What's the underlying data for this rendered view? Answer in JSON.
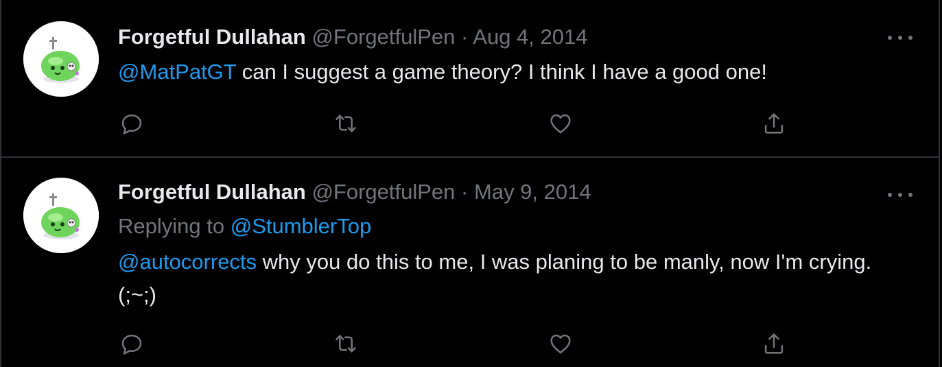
{
  "tweets": [
    {
      "author_name": "Forgetful Dullahan",
      "handle": "@ForgetfulPen",
      "separator": "·",
      "date": "Aug 4, 2014",
      "replying_label": "",
      "replying_to": "",
      "mention": "@MatPatGT",
      "text": " can I suggest a game theory? I think I have a good one!"
    },
    {
      "author_name": "Forgetful Dullahan",
      "handle": "@ForgetfulPen",
      "separator": "·",
      "date": "May 9, 2014",
      "replying_label": "Replying to ",
      "replying_to": "@StumblerTop",
      "mention": "@autocorrects",
      "text": " why you do this to me, I was planing to be manly, now I'm crying. (;~;)"
    }
  ],
  "icons": {
    "avatar": "green-slime-avatar-icon",
    "more": "more-options-icon",
    "reply": "reply-icon",
    "retweet": "retweet-icon",
    "like": "heart-icon",
    "share": "share-icon"
  },
  "colors": {
    "background": "#000000",
    "text": "#e7e9ea",
    "muted": "#71767b",
    "link": "#1d9bf0",
    "divider": "#2f3336",
    "avatar_slime": "#6fd45c"
  }
}
